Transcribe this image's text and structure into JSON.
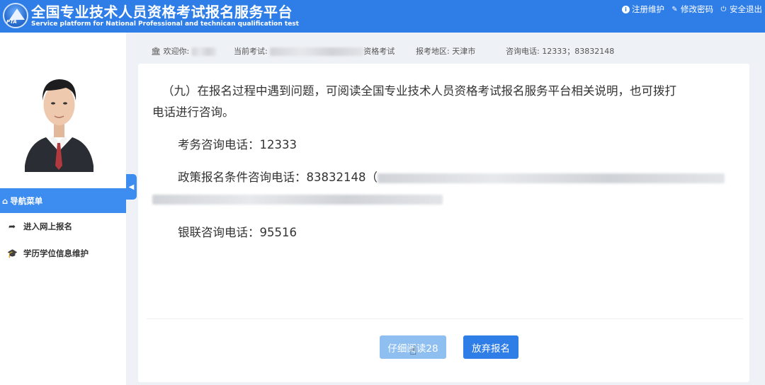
{
  "header": {
    "title_cn": "全国专业技术人员资格考试报名服务平台",
    "title_en": "Service platform for National Professional and technican qualification test",
    "logo_text": "PTA",
    "links": [
      {
        "label": "注册维护",
        "icon": "info-icon"
      },
      {
        "label": "修改密码",
        "icon": "edit-icon"
      },
      {
        "label": "安全退出",
        "icon": "power-icon"
      }
    ]
  },
  "sidebar": {
    "nav_title": "导航菜单",
    "items": [
      {
        "label": "进入网上报名",
        "icon": "share-arrow-icon"
      },
      {
        "label": "学历学位信息维护",
        "icon": "graduation-cap-icon"
      }
    ]
  },
  "infobar": {
    "welcome_label": "欢迎你:",
    "exam_label": "当前考试:",
    "exam_suffix": "资格考试",
    "region_label": "报考地区:",
    "region_value": "天津市",
    "phone_label": "咨询电话:",
    "phone_value": "12333；83832148"
  },
  "content": {
    "p1_line1": "（九）在报名过程中遇到问题，可阅读全国专业技术人员资格考试报名服务平台相关说明，也可拨打",
    "p1_line2": "电话进行咨询。",
    "p2": "考务咨询电话：12333",
    "p3": "政策报名条件咨询电话：83832148（",
    "p4": "银联咨询电话：95516"
  },
  "buttons": {
    "read": "仔细阅读28",
    "quit": "放弃报名"
  },
  "colors": {
    "header_bg": "#2f7ee8",
    "nav_active": "#3d8df0",
    "btn_disabled": "#8ebff0",
    "btn_primary": "#2f7ee8"
  }
}
